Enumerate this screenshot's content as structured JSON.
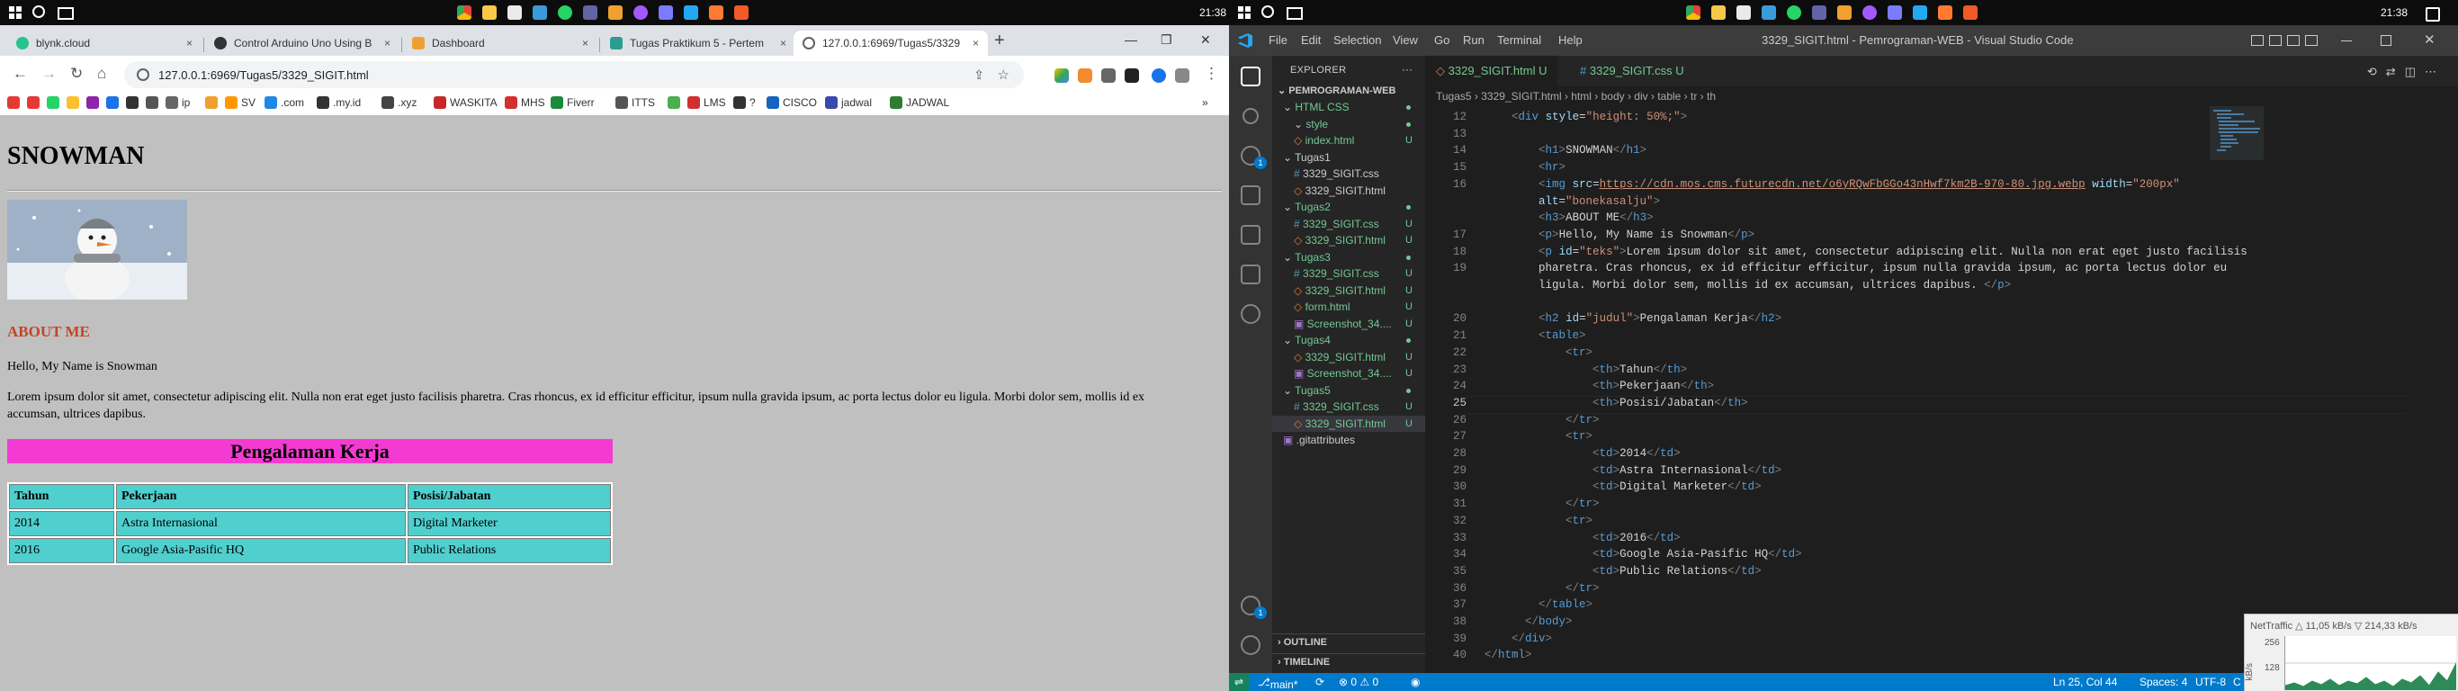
{
  "left_taskbar": {
    "clock": "21:38"
  },
  "right_taskbar": {
    "clock": "21:38"
  },
  "browser": {
    "tabs": [
      {
        "label": "blynk.cloud",
        "x": "×"
      },
      {
        "label": "Control Arduino Uno Using B",
        "x": "×"
      },
      {
        "label": "Dashboard",
        "x": "×"
      },
      {
        "label": "Tugas Praktikum 5 - Pertem",
        "x": "×"
      },
      {
        "label": "127.0.0.1:6969/Tugas5/3329",
        "x": "×"
      }
    ],
    "new_tab": "+",
    "window_controls": [
      "—",
      "❐",
      "✕"
    ],
    "url": "127.0.0.1:6969/Tugas5/3329_SIGIT.html",
    "bookmarks": [
      " ",
      " ",
      " ",
      " ",
      " ",
      " ",
      " ",
      " ",
      "ip",
      " ",
      "SV",
      ".com",
      ".my.id",
      ".xyz",
      "WASKITA",
      "MHS",
      "Fiverr",
      "ITTS",
      " ",
      "LMS",
      "?",
      "CISCO",
      "jadwal",
      "JADWAL"
    ],
    "bookmarks_more": "»"
  },
  "page": {
    "title": "SNOWMAN",
    "about_heading": "ABOUT ME",
    "greeting": "Hello, My Name is Snowman",
    "lorem": "Lorem ipsum dolor sit amet, consectetur adipiscing elit. Nulla non erat eget justo facilisis pharetra. Cras rhoncus, ex id efficitur efficitur, ipsum nulla gravida ipsum, ac porta lectus dolor eu ligula. Morbi dolor sem, mollis id ex accumsan, ultrices dapibus.",
    "section_heading": "Pengalaman Kerja",
    "table": {
      "headers": [
        "Tahun",
        "Pekerjaan",
        "Posisi/Jabatan"
      ],
      "rows": [
        [
          "2014",
          "Astra Internasional",
          "Digital Marketer"
        ],
        [
          "2016",
          "Google Asia-Pasific HQ",
          "Public Relations"
        ]
      ]
    }
  },
  "vscode": {
    "window_title": "3329_SIGIT.html - Pemrograman-WEB - Visual Studio Code",
    "menu": [
      "File",
      "Edit",
      "Selection",
      "View",
      "Go",
      "Run",
      "Terminal",
      "Help"
    ],
    "explorer_label": "EXPLORER",
    "explorer_more": "···",
    "root_folder": "PEMROGRAMAN-WEB",
    "tree": [
      {
        "label": "HTML CSS",
        "mark": "dot",
        "indent": 1
      },
      {
        "label": "style",
        "mark": "dot",
        "indent": 2
      },
      {
        "label": "index.html",
        "mark": "U",
        "indent": 2
      },
      {
        "label": "Tugas1",
        "mark": "",
        "indent": 1
      },
      {
        "label": "3329_SIGIT.css",
        "mark": "",
        "indent": 2
      },
      {
        "label": "3329_SIGIT.html",
        "mark": "",
        "indent": 2
      },
      {
        "label": "Tugas2",
        "mark": "dot",
        "indent": 1
      },
      {
        "label": "3329_SIGIT.css",
        "mark": "U",
        "indent": 2
      },
      {
        "label": "3329_SIGIT.html",
        "mark": "U",
        "indent": 2
      },
      {
        "label": "Tugas3",
        "mark": "dot",
        "indent": 1
      },
      {
        "label": "3329_SIGIT.css",
        "mark": "U",
        "indent": 2
      },
      {
        "label": "3329_SIGIT.html",
        "mark": "U",
        "indent": 2
      },
      {
        "label": "form.html",
        "mark": "U",
        "indent": 2
      },
      {
        "label": "Screenshot_34....",
        "mark": "U",
        "indent": 2
      },
      {
        "label": "Tugas4",
        "mark": "dot",
        "indent": 1
      },
      {
        "label": "3329_SIGIT.html",
        "mark": "U",
        "indent": 2
      },
      {
        "label": "Screenshot_34....",
        "mark": "U",
        "indent": 2
      },
      {
        "label": "Tugas5",
        "mark": "dot",
        "indent": 1
      },
      {
        "label": "3329_SIGIT.css",
        "mark": "U",
        "indent": 2
      },
      {
        "label": "3329_SIGIT.html",
        "mark": "U",
        "indent": 2
      },
      {
        "label": ".gitattributes",
        "mark": "",
        "indent": 1
      }
    ],
    "outline": "OUTLINE",
    "timeline": "TIMELINE",
    "editor_tabs": [
      {
        "label": "3329_SIGIT.html",
        "mark": "U",
        "active": true
      },
      {
        "label": "3329_SIGIT.css",
        "mark": "U",
        "active": false
      }
    ],
    "breadcrumb": "Tugas5 › 3329_SIGIT.html › html › body › div › table › tr › th",
    "code_lines": [
      {
        "n": "12",
        "html": "    <span class='br'>&lt;</span><span class='tag'>div</span> <span class='at'>style</span>=<span class='st'>\"height: 50%;\"</span><span class='br'>&gt;</span>"
      },
      {
        "n": "13",
        "html": ""
      },
      {
        "n": "14",
        "html": "        <span class='br'>&lt;</span><span class='tag'>h1</span><span class='br'>&gt;</span>SNOWMAN<span class='br'>&lt;/</span><span class='tag'>h1</span><span class='br'>&gt;</span>"
      },
      {
        "n": "15",
        "html": "        <span class='br'>&lt;</span><span class='tag'>hr</span><span class='br'>&gt;</span>"
      },
      {
        "n": "16",
        "html": "        <span class='br'>&lt;</span><span class='tag'>img</span> <span class='at'>src</span>=<span class='lk'>https://cdn.mos.cms.futurecdn.net/o6yRQwFbGGo43nHwf7km2B-970-80.jpg.webp</span> <span class='at'>width</span>=<span class='st'>\"200px\"</span>"
      },
      {
        "n": "",
        "html": "        <span class='at'>alt</span>=<span class='st'>\"bonekasalju\"</span><span class='br'>&gt;</span>"
      },
      {
        "n": "",
        "html": "        <span class='br'>&lt;</span><span class='tag'>h3</span><span class='br'>&gt;</span>ABOUT ME<span class='br'>&lt;/</span><span class='tag'>h3</span><span class='br'>&gt;</span>"
      },
      {
        "n": "17",
        "html": "        <span class='br'>&lt;</span><span class='tag'>p</span><span class='br'>&gt;</span>Hello, My Name is Snowman<span class='br'>&lt;/</span><span class='tag'>p</span><span class='br'>&gt;</span>"
      },
      {
        "n": "18",
        "html": "        <span class='br'>&lt;</span><span class='tag'>p</span> <span class='at'>id</span>=<span class='st'>\"teks\"</span><span class='br'>&gt;</span>Lorem ipsum dolor sit amet, consectetur adipiscing elit. Nulla non erat eget justo facilisis"
      },
      {
        "n": "19",
        "html": "        pharetra. Cras rhoncus, ex id efficitur efficitur, ipsum nulla gravida ipsum, ac porta lectus dolor eu"
      },
      {
        "n": "",
        "html": "        ligula. Morbi dolor sem, mollis id ex accumsan, ultrices dapibus. <span class='br'>&lt;/</span><span class='tag'>p</span><span class='br'>&gt;</span>"
      },
      {
        "n": "",
        "html": ""
      },
      {
        "n": "20",
        "html": "        <span class='br'>&lt;</span><span class='tag'>h2</span> <span class='at'>id</span>=<span class='st'>\"judul\"</span><span class='br'>&gt;</span>Pengalaman Kerja<span class='br'>&lt;/</span><span class='tag'>h2</span><span class='br'>&gt;</span>"
      },
      {
        "n": "21",
        "html": "        <span class='br'>&lt;</span><span class='tag'>table</span><span class='br'>&gt;</span>"
      },
      {
        "n": "22",
        "html": "            <span class='br'>&lt;</span><span class='tag'>tr</span><span class='br'>&gt;</span>"
      },
      {
        "n": "23",
        "html": "                <span class='br'>&lt;</span><span class='tag'>th</span><span class='br'>&gt;</span>Tahun<span class='br'>&lt;/</span><span class='tag'>th</span><span class='br'>&gt;</span>"
      },
      {
        "n": "24",
        "html": "                <span class='br'>&lt;</span><span class='tag'>th</span><span class='br'>&gt;</span>Pekerjaan<span class='br'>&lt;/</span><span class='tag'>th</span><span class='br'>&gt;</span>"
      },
      {
        "n": "25",
        "html": "                <span class='br'>&lt;</span><span class='tag'>th</span><span class='br'>&gt;</span>Posisi/Jabatan<span class='br'>&lt;/</span><span class='tag'>th</span><span class='br'>&gt;</span>"
      },
      {
        "n": "26",
        "html": "            <span class='br'>&lt;/</span><span class='tag'>tr</span><span class='br'>&gt;</span>"
      },
      {
        "n": "27",
        "html": "            <span class='br'>&lt;</span><span class='tag'>tr</span><span class='br'>&gt;</span>"
      },
      {
        "n": "28",
        "html": "                <span class='br'>&lt;</span><span class='tag'>td</span><span class='br'>&gt;</span>2014<span class='br'>&lt;/</span><span class='tag'>td</span><span class='br'>&gt;</span>"
      },
      {
        "n": "29",
        "html": "                <span class='br'>&lt;</span><span class='tag'>td</span><span class='br'>&gt;</span>Astra Internasional<span class='br'>&lt;/</span><span class='tag'>td</span><span class='br'>&gt;</span>"
      },
      {
        "n": "30",
        "html": "                <span class='br'>&lt;</span><span class='tag'>td</span><span class='br'>&gt;</span>Digital Marketer<span class='br'>&lt;/</span><span class='tag'>td</span><span class='br'>&gt;</span>"
      },
      {
        "n": "31",
        "html": "            <span class='br'>&lt;/</span><span class='tag'>tr</span><span class='br'>&gt;</span>"
      },
      {
        "n": "32",
        "html": "            <span class='br'>&lt;</span><span class='tag'>tr</span><span class='br'>&gt;</span>"
      },
      {
        "n": "33",
        "html": "                <span class='br'>&lt;</span><span class='tag'>td</span><span class='br'>&gt;</span>2016<span class='br'>&lt;/</span><span class='tag'>td</span><span class='br'>&gt;</span>"
      },
      {
        "n": "34",
        "html": "                <span class='br'>&lt;</span><span class='tag'>td</span><span class='br'>&gt;</span>Google Asia-Pasific HQ<span class='br'>&lt;/</span><span class='tag'>td</span><span class='br'>&gt;</span>"
      },
      {
        "n": "35",
        "html": "                <span class='br'>&lt;</span><span class='tag'>td</span><span class='br'>&gt;</span>Public Relations<span class='br'>&lt;/</span><span class='tag'>td</span><span class='br'>&gt;</span>"
      },
      {
        "n": "36",
        "html": "            <span class='br'>&lt;/</span><span class='tag'>tr</span><span class='br'>&gt;</span>"
      },
      {
        "n": "37",
        "html": "        <span class='br'>&lt;/</span><span class='tag'>table</span><span class='br'>&gt;</span>"
      },
      {
        "n": "38",
        "html": "      <span class='br'>&lt;/</span><span class='tag'>body</span><span class='br'>&gt;</span>"
      },
      {
        "n": "39",
        "html": "    <span class='br'>&lt;/</span><span class='tag'>div</span><span class='br'>&gt;</span>"
      },
      {
        "n": "40",
        "html": "<span class='br'>&lt;/</span><span class='tag'>html</span><span class='br'>&gt;</span>"
      }
    ],
    "current_line": "25",
    "status": {
      "branch": "main*",
      "sync": "⟳",
      "problems": "⊗ 0 ⚠ 0",
      "position": "Ln 25, Col 44",
      "spaces": "Spaces: 4",
      "encoding": "UTF-8",
      "eol": "C"
    },
    "activity_badges": [
      "1",
      "1"
    ]
  },
  "net_widget": {
    "title": "NetTraffic △ 11,05 kB/s ▽ 214,33 kB/s",
    "y_top": "256",
    "y_mid": "128",
    "unit": "kB/s"
  },
  "colors": {
    "page_bg": "#c0c0c0",
    "about_color": "#c44524",
    "judul_bg": "#f33bd2",
    "table_cell_bg": "#4fcfcd",
    "vscode_status": "#007acc"
  }
}
